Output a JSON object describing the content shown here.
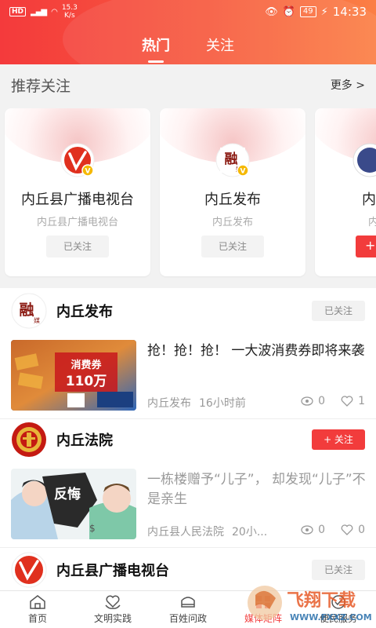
{
  "status_bar": {
    "network": "HD",
    "signal": "4G",
    "speed": "15.3",
    "speed_unit": "K/s",
    "battery": "49",
    "time": "14:33"
  },
  "top_tabs": [
    {
      "label": "热门",
      "active": true
    },
    {
      "label": "关注",
      "active": false
    }
  ],
  "recommend": {
    "title": "推荐关注",
    "more_label": "更多 >",
    "cards": [
      {
        "name": "内丘县广播电视台",
        "subtitle": "内丘县广播电视台",
        "button": "已关注",
        "icon": "radio-tv-logo"
      },
      {
        "name": "内丘发布",
        "subtitle": "内丘发布",
        "button": "已关注",
        "icon": "rong-media-logo"
      },
      {
        "name": "内",
        "subtitle": "内",
        "button": "+",
        "icon": "partial-logo"
      }
    ]
  },
  "feed": [
    {
      "author": "内丘发布",
      "follow_label": "已关注",
      "follow_state": "followed",
      "post": {
        "title": "抢！抢！抢！ 一大波消费券即将来袭",
        "source": "内丘发布",
        "time": "16小时前",
        "views": "0",
        "likes": "1",
        "thumb_text": "消费券",
        "thumb_text2": "110万"
      }
    },
    {
      "author": "内丘法院",
      "follow_label": "+ 关注",
      "follow_state": "not-followed",
      "post": {
        "title": "一栋楼赠予“儿子”， 却发现“儿子”不是亲生",
        "source": "内丘县人民法院",
        "time": "20小...",
        "views": "0",
        "likes": "0",
        "thumb_text": "反悔"
      }
    },
    {
      "author": "内丘县广播电视台",
      "follow_label": "已关注",
      "follow_state": "followed"
    }
  ],
  "bottom_nav": [
    {
      "label": "首页",
      "icon": "home-icon",
      "active": false
    },
    {
      "label": "文明实践",
      "icon": "heart-hands-icon",
      "active": false
    },
    {
      "label": "百姓问政",
      "icon": "question-icon",
      "active": false
    },
    {
      "label": "媒体矩阵",
      "icon": "matrix-icon",
      "active": true
    },
    {
      "label": "便民服务",
      "icon": "service-icon",
      "active": false
    }
  ],
  "watermark": "飞翔下载 WWW.FXXZ.COM",
  "colors": {
    "accent": "#f23c3c",
    "header_start": "#f43a3c",
    "header_end": "#fb7f45"
  }
}
